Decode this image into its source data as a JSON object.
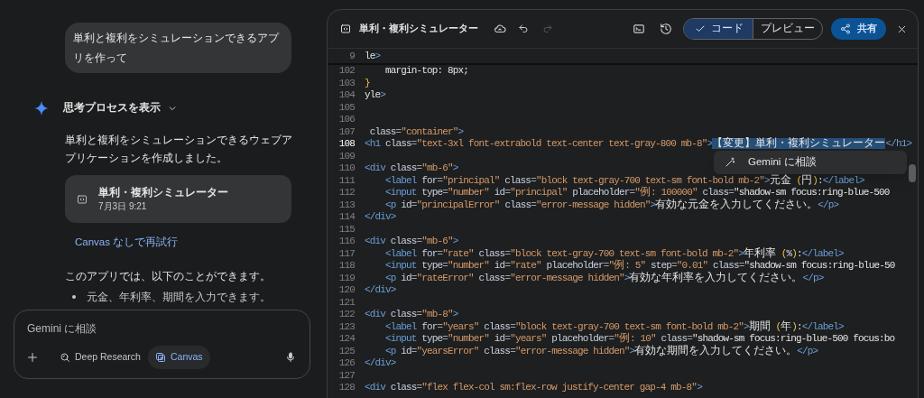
{
  "chat": {
    "user_message": "単利と複利をシミュレーションできるアプリを作って",
    "thinking_toggle": {
      "label": "思考プロセスを表示",
      "expanded": false
    },
    "response_text": "単利と複利をシミュレーションできるウェブアプリケーションを作成しました。",
    "canvas_card": {
      "title": "単利・複利シミュレーター",
      "timestamp": "7月3日 9:21"
    },
    "retry_link": "Canvas なしで再試行",
    "summary": "このアプリでは、以下のことができます。",
    "bullets": [
      "元金、年利率、期間を入力できます。"
    ]
  },
  "composer": {
    "placeholder": "Gemini に相談",
    "tools": [
      {
        "kind": "deep_research",
        "label": "Deep Research",
        "selected": false
      },
      {
        "kind": "canvas",
        "label": "Canvas",
        "selected": true
      }
    ]
  },
  "editor": {
    "title": "単利・複利シミュレーター",
    "redo_disabled": true,
    "view_tabs": [
      {
        "label": "コード",
        "selected": true
      },
      {
        "label": "プレビュー",
        "selected": false
      }
    ],
    "share_label": "共有",
    "context_menu": {
      "label": "Gemini に相談"
    },
    "lines": [
      {
        "kind": "sticky",
        "number": "9",
        "text": "le>",
        "current": false
      },
      {
        "kind": "code",
        "number": "102",
        "text": "    margin-top: 8px;",
        "current": false
      },
      {
        "kind": "code",
        "number": "103",
        "text": "}",
        "current": false
      },
      {
        "kind": "code",
        "number": "104",
        "text": "yle>",
        "current": false
      },
      {
        "kind": "code",
        "number": "105",
        "current": false
      },
      {
        "kind": "code",
        "number": "106",
        "current": false
      },
      {
        "kind": "code",
        "number": "107",
        "text": " class=\"container\">",
        "current": false
      },
      {
        "kind": "code",
        "number": "108",
        "text": "<h1 class=\"text-3xl font-extrabold text-center text-gray-800 mb-8\">",
        "selection": "【変更】単利・複利シミュレーター",
        "rest": "</h1>",
        "current": true
      },
      {
        "kind": "code",
        "number": "109",
        "current": false
      },
      {
        "kind": "code",
        "number": "110",
        "text": "<div class=\"mb-6\">",
        "current": false
      },
      {
        "kind": "code",
        "number": "111",
        "text": "    <label for=\"principal\" class=\"block text-gray-700 text-sm font-bold mb-2\">元金 (円):</label>",
        "current": false
      },
      {
        "kind": "code",
        "number": "112",
        "text": "    <input type=\"number\" id=\"principal\" placeholder=\"例: 100000\" class=\"shadow-sm focus:ring-blue-500",
        "current": false
      },
      {
        "kind": "code",
        "number": "113",
        "text": "    <p id=\"principalError\" class=\"error-message hidden\">有効な元金を入力してください。</p>",
        "current": false
      },
      {
        "kind": "code",
        "number": "114",
        "text": "</div>",
        "current": false
      },
      {
        "kind": "code",
        "number": "115",
        "current": false
      },
      {
        "kind": "code",
        "number": "116",
        "text": "<div class=\"mb-6\">",
        "current": false
      },
      {
        "kind": "code",
        "number": "117",
        "text": "    <label for=\"rate\" class=\"block text-gray-700 text-sm font-bold mb-2\">年利率 (%):</label>",
        "current": false
      },
      {
        "kind": "code",
        "number": "118",
        "text": "    <input type=\"number\" id=\"rate\" placeholder=\"例: 5\" step=\"0.01\" class=\"shadow-sm focus:ring-blue-50",
        "current": false
      },
      {
        "kind": "code",
        "number": "119",
        "text": "    <p id=\"rateError\" class=\"error-message hidden\">有効な年利率を入力してください。</p>",
        "current": false
      },
      {
        "kind": "code",
        "number": "120",
        "text": "</div>",
        "current": false
      },
      {
        "kind": "code",
        "number": "121",
        "current": false
      },
      {
        "kind": "code",
        "number": "122",
        "text": "<div class=\"mb-8\">",
        "current": false
      },
      {
        "kind": "code",
        "number": "123",
        "text": "    <label for=\"years\" class=\"block text-gray-700 text-sm font-bold mb-2\">期間 (年):</label>",
        "current": false
      },
      {
        "kind": "code",
        "number": "124",
        "text": "    <input type=\"number\" id=\"years\" placeholder=\"例: 10\" class=\"shadow-sm focus:ring-blue-500 focus:bo",
        "current": false
      },
      {
        "kind": "code",
        "number": "125",
        "text": "    <p id=\"yearsError\" class=\"error-message hidden\">有効な期間を入力してください。</p>",
        "current": false
      },
      {
        "kind": "code",
        "number": "126",
        "text": "</div>",
        "current": false
      },
      {
        "kind": "code",
        "number": "127",
        "current": false
      },
      {
        "kind": "code",
        "number": "128",
        "text": "<div class=\"flex flex-col sm:flex-row justify-center gap-4 mb-8\">",
        "current": false
      }
    ]
  }
}
